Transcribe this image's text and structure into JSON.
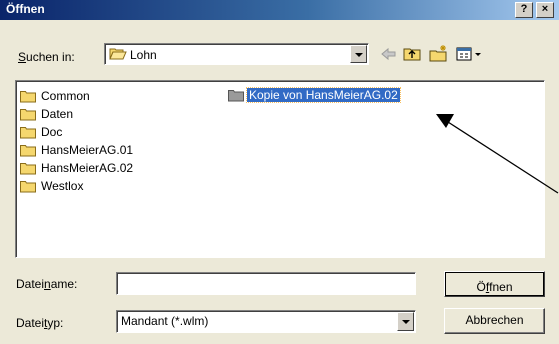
{
  "window": {
    "title": "Öffnen",
    "help_label": "?",
    "close_label": "×"
  },
  "lookin": {
    "label_pre": "",
    "label_accel": "S",
    "label_post": "uchen in:",
    "value": "Lohn"
  },
  "toolbar": {
    "icons": [
      "back-arrow-icon",
      "up-one-level-icon",
      "new-folder-icon",
      "view-menu-icon"
    ]
  },
  "files": {
    "items": [
      {
        "label": "Common",
        "selected": false
      },
      {
        "label": "Daten",
        "selected": false
      },
      {
        "label": "Doc",
        "selected": false
      },
      {
        "label": "HansMeierAG.01",
        "selected": false
      },
      {
        "label": "HansMeierAG.02",
        "selected": false
      },
      {
        "label": "Westlox",
        "selected": false
      },
      {
        "label": "Kopie von HansMeierAG.02",
        "selected": true
      }
    ]
  },
  "filename": {
    "label_pre": "Datei",
    "label_accel": "n",
    "label_post": "ame:",
    "value": ""
  },
  "filetype": {
    "label_pre": "Datei",
    "label_accel": "t",
    "label_post": "yp:",
    "value": "Mandant (*.wlm)"
  },
  "buttons": {
    "open_pre": "Ö",
    "open_accel": "f",
    "open_post": "fnen",
    "cancel": "Abbrechen"
  },
  "colors": {
    "folder": "#f5d76e",
    "folder_gray": "#9a9a9a",
    "selection": "#316ac5",
    "titlebar": "#0a246a"
  }
}
